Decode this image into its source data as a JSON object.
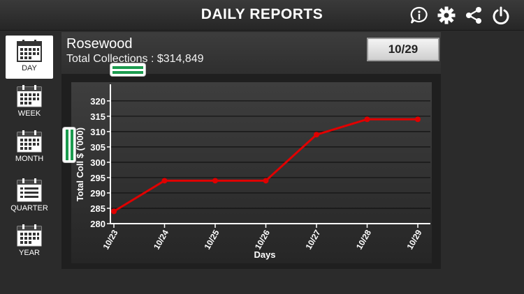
{
  "app": {
    "title": "DAILY REPORTS"
  },
  "toolbar_icons": [
    "info-icon",
    "gear-icon",
    "share-icon",
    "power-icon"
  ],
  "sidebar": {
    "items": [
      {
        "label": "DAY",
        "icon": "calendar-icon",
        "active": true
      },
      {
        "label": "WEEK",
        "icon": "calendar-icon",
        "active": false
      },
      {
        "label": "MONTH",
        "icon": "calendar-icon",
        "active": false
      },
      {
        "label": "QUARTER",
        "icon": "list-calendar-icon",
        "active": false
      },
      {
        "label": "YEAR",
        "icon": "calendar-icon",
        "active": false
      }
    ]
  },
  "header": {
    "store_name": "Rosewood",
    "collections": "Total Collections : $314,849",
    "date_button": "10/29"
  },
  "colors": {
    "line": "#e00000",
    "accent_handle": "#1b9b4e"
  },
  "chart_data": {
    "type": "line",
    "x": [
      "10/23",
      "10/24",
      "10/25",
      "10/26",
      "10/27",
      "10/28",
      "10/29"
    ],
    "series": [
      {
        "values": [
          284,
          294,
          294,
          294,
          309,
          314,
          314
        ]
      }
    ],
    "xlabel": "Days",
    "ylabel": "Total Coll $ ('000)",
    "ylim": [
      280,
      322
    ],
    "yticks": [
      280,
      285,
      290,
      295,
      300,
      305,
      310,
      315,
      320
    ],
    "grid": true
  }
}
